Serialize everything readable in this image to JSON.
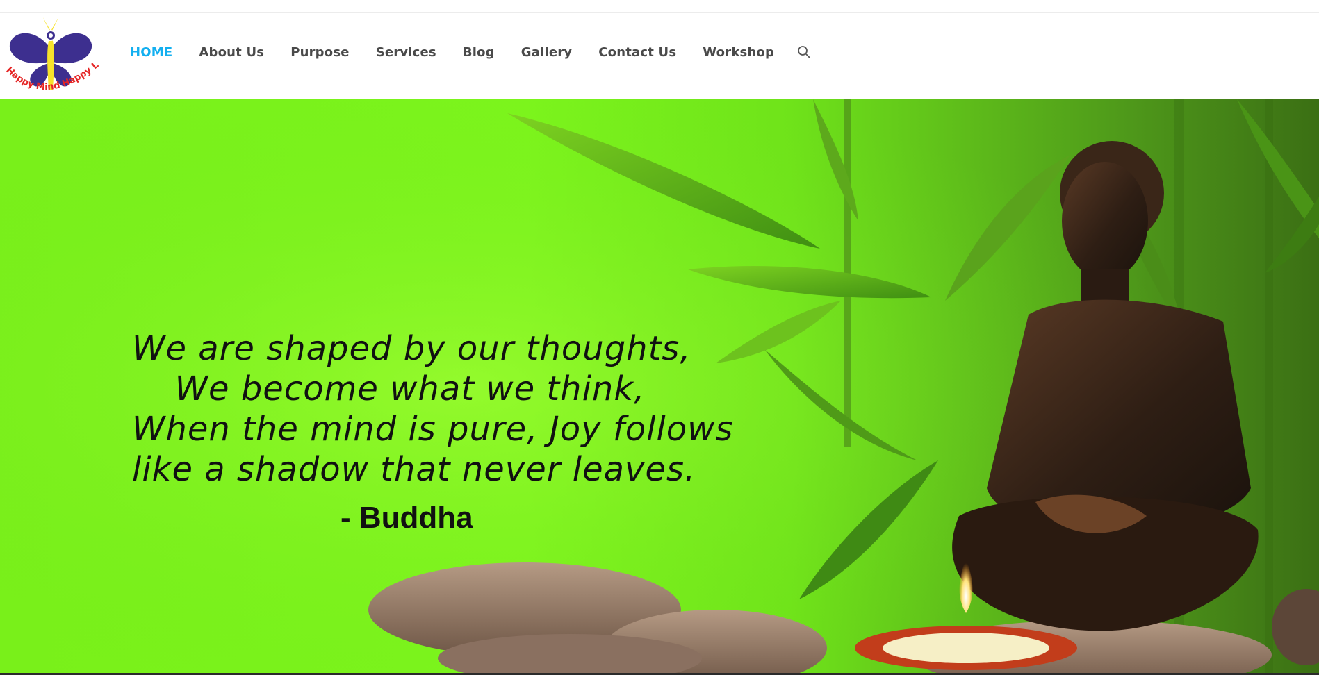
{
  "logo": {
    "text": "Happy Mind Happy Life",
    "colors": {
      "wing": "#3d2f8f",
      "body": "#f7e22b",
      "text": "#e52424"
    }
  },
  "nav": {
    "items": [
      {
        "label": "HOME",
        "active": true
      },
      {
        "label": "About Us"
      },
      {
        "label": "Purpose"
      },
      {
        "label": "Services"
      },
      {
        "label": "Blog"
      },
      {
        "label": "Gallery"
      },
      {
        "label": "Contact Us"
      },
      {
        "label": "Workshop"
      }
    ],
    "search_icon": "search-icon",
    "active_color": "#13aff0",
    "text_color": "#4a4a4a"
  },
  "hero": {
    "quote_lines": [
      "We are shaped by our thoughts,",
      "We become what we think,",
      "When the mind is pure, Joy follows",
      "like a shadow that never leaves."
    ],
    "author": "- Buddha",
    "background_color": "#7cf51c"
  }
}
